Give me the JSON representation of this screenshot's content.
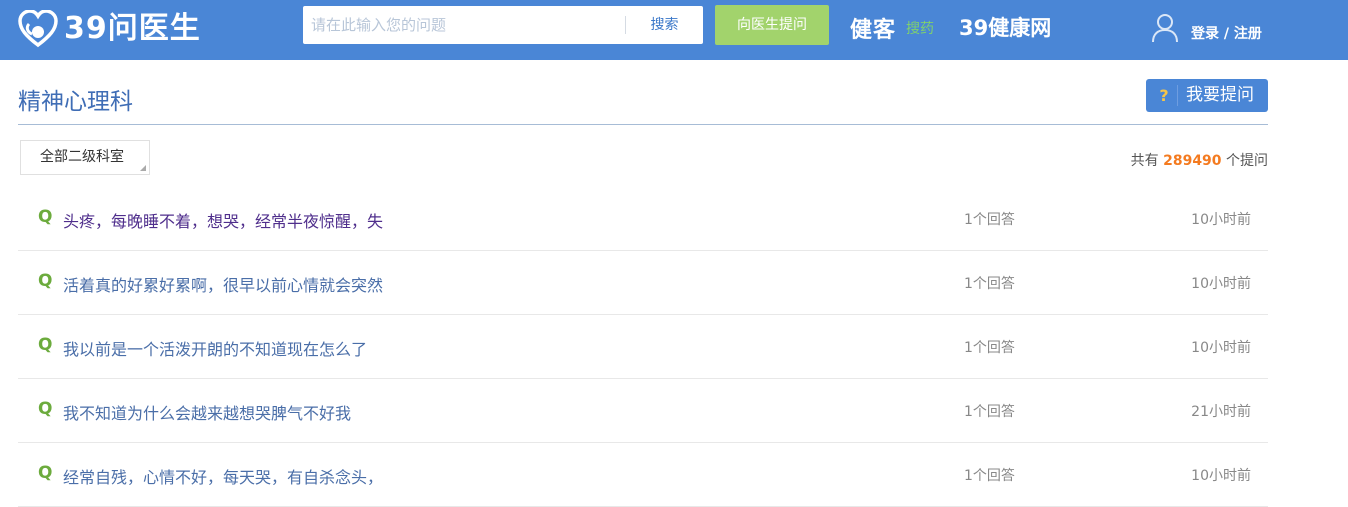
{
  "header": {
    "logo_text": "39问医生",
    "search_placeholder": "请在此输入您的问题",
    "search_button": "搜索",
    "ask_doctor_button": "向医生提问",
    "jianke": "健客",
    "jianke_sub": "搜药",
    "site39": "39健康网",
    "login": "登录 / 注册",
    "colors": {
      "bar": "#4a86d6",
      "ask_button": "#a2d36c"
    }
  },
  "page": {
    "title": "精神心理科",
    "ask_question_button": "我要提问",
    "ask_icon": "?",
    "filter_dropdown": "全部二级科室",
    "total_prefix": "共有",
    "total_count": "289490",
    "total_suffix": "个提问"
  },
  "questions": [
    {
      "q": "Q",
      "text": "头疼，每晚睡不着，想哭，经常半夜惊醒，失",
      "answers": "1个回答",
      "time": "10小时前"
    },
    {
      "q": "Q",
      "text": "活着真的好累好累啊，很早以前心情就会突然",
      "answers": "1个回答",
      "time": "10小时前"
    },
    {
      "q": "Q",
      "text": "我以前是一个活泼开朗的不知道现在怎么了",
      "answers": "1个回答",
      "time": "10小时前"
    },
    {
      "q": "Q",
      "text": "我不知道为什么会越来越想哭脾气不好我",
      "answers": "1个回答",
      "time": "21小时前"
    },
    {
      "q": "Q",
      "text": "经常自残，心情不好，每天哭，有自杀念头，",
      "answers": "1个回答",
      "time": "10小时前"
    }
  ]
}
